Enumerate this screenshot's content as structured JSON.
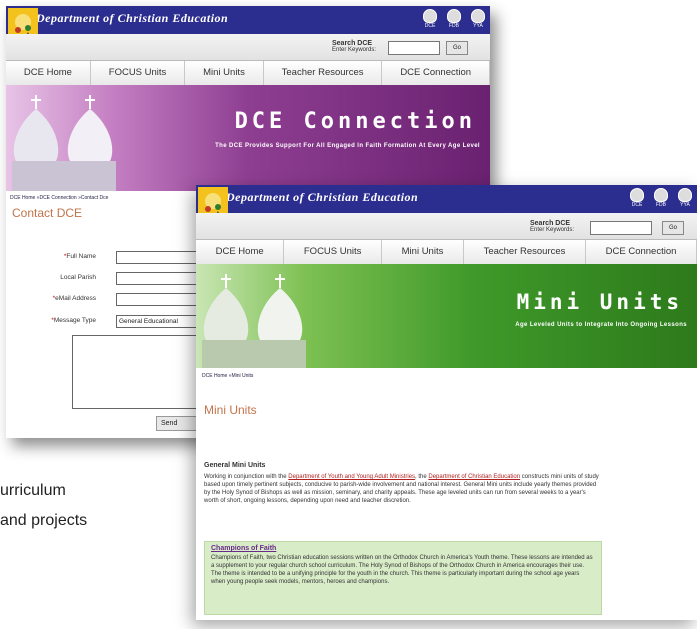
{
  "site": {
    "title": "Department of Christian Education",
    "icons": [
      {
        "name": "dce-icon",
        "label": "DCE"
      },
      {
        "name": "fdb-icon",
        "label": "FDB"
      },
      {
        "name": "yya-icon",
        "label": "YYA"
      }
    ],
    "search_label": "Search DCE",
    "search_sub": "Enter Keywords:",
    "go_label": "Go"
  },
  "nav": [
    "DCE Home",
    "FOCUS Units",
    "Mini Units",
    "Teacher Resources",
    "DCE Connection"
  ],
  "back_page": {
    "banner_title": "DCE Connection",
    "banner_subtitle": "The DCE Provides Support For All Engaged In Faith Formation At Every Age Level",
    "breadcrumb": "DCE Home »DCE Connection »Contact Dce",
    "heading": "Contact DCE",
    "form": [
      {
        "label": "Full Name",
        "required": true,
        "value": ""
      },
      {
        "label": "Local Parish",
        "required": false,
        "value": ""
      },
      {
        "label": "eMail Address",
        "required": true,
        "value": ""
      },
      {
        "label": "Message Type",
        "required": true,
        "value": "General Educational"
      }
    ],
    "send_label": "Send"
  },
  "front_page": {
    "banner_title": "Mini Units",
    "banner_subtitle": "Age Leveled Units to Integrate Into Ongoing Lessons",
    "breadcrumb": "DCE Home »Mini Units",
    "heading": "Mini Units",
    "section_heading": "General Mini Units",
    "para_before_link1": "Working in conjunction with the ",
    "link1": "Department of Youth and Young Adult Ministries",
    "para_mid": ", the ",
    "link2": "Department of Christian Education",
    "para_after": " constructs mini units of study based upon timely pertinent subjects, conducive to parish-wide involvement and national interest. General Mini units include yearly themes provided by the Holy Synod of Bishops as well as mission, seminary, and charity appeals. These age leveled units can run from several weeks to a year's worth of short, ongoing lessons, depending upon need and teacher discretion.",
    "box_heading": "Champions of Faith",
    "box_text": "Champions of Faith, two Christian education sessions written on the Orthodox Church in America's Youth theme. These lessons are intended as a supplement to your regular church school curriculum. The Holy Synod of Bishops of the Orthodox Church in America encourages their use. The theme is intended to be a unifying principle for the youth in the church. This theme is particularly important during the school age years when young people seek models, mentors, heroes and champions."
  },
  "page_text": {
    "line1": "urriculum",
    "line2": "and projects"
  }
}
